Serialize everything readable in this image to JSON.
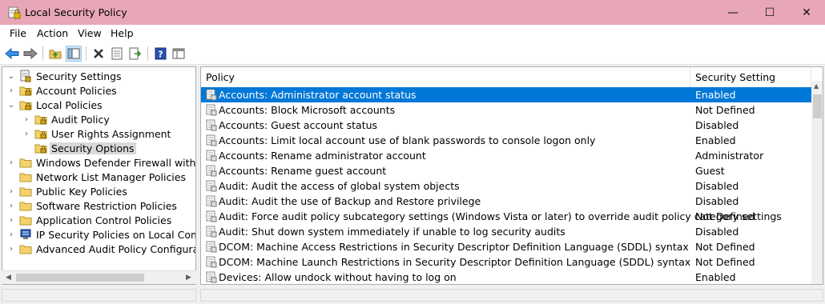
{
  "window": {
    "title": "Local Security Policy",
    "minimize_glyph": "—",
    "maximize_glyph": "☐",
    "close_glyph": "✕"
  },
  "menu": [
    "File",
    "Action",
    "View",
    "Help"
  ],
  "toolbar": {
    "icons": [
      "back-arrow-icon",
      "forward-arrow-icon",
      "up-folder-icon",
      "show-hide-tree-icon",
      "delete-icon",
      "properties-icon",
      "export-list-icon",
      "help-icon",
      "console-view-icon"
    ]
  },
  "tree": {
    "items": [
      {
        "label": "Security Settings",
        "arrow": "⌄",
        "icon": "security-settings-icon"
      },
      {
        "label": "Account Policies",
        "arrow": "›",
        "icon": "folder-lock-icon"
      },
      {
        "label": "Local Policies",
        "arrow": "⌄",
        "icon": "folder-lock-icon"
      },
      {
        "label": "Audit Policy",
        "arrow": "›",
        "icon": "folder-lock-icon"
      },
      {
        "label": "User Rights Assignment",
        "arrow": "›",
        "icon": "folder-lock-icon"
      },
      {
        "label": "Security Options",
        "arrow": "",
        "icon": "folder-lock-icon"
      },
      {
        "label": "Windows Defender Firewall with Adva",
        "arrow": "›",
        "icon": "folder-icon"
      },
      {
        "label": "Network List Manager Policies",
        "arrow": "",
        "icon": "folder-icon"
      },
      {
        "label": "Public Key Policies",
        "arrow": "›",
        "icon": "folder-icon"
      },
      {
        "label": "Software Restriction Policies",
        "arrow": "›",
        "icon": "folder-icon"
      },
      {
        "label": "Application Control Policies",
        "arrow": "›",
        "icon": "folder-icon"
      },
      {
        "label": "IP Security Policies on Local Compute",
        "arrow": "›",
        "icon": "ip-security-icon"
      },
      {
        "label": "Advanced Audit Policy Configuration",
        "arrow": "›",
        "icon": "folder-icon"
      }
    ],
    "selected": "Security Options"
  },
  "table": {
    "columns": [
      "Policy",
      "Security Setting"
    ],
    "sort_glyph": "^",
    "rows": [
      {
        "policy": "Accounts: Administrator account status",
        "setting": "Enabled"
      },
      {
        "policy": "Accounts: Block Microsoft accounts",
        "setting": "Not Defined"
      },
      {
        "policy": "Accounts: Guest account status",
        "setting": "Disabled"
      },
      {
        "policy": "Accounts: Limit local account use of blank passwords to console logon only",
        "setting": "Enabled"
      },
      {
        "policy": "Accounts: Rename administrator account",
        "setting": "Administrator"
      },
      {
        "policy": "Accounts: Rename guest account",
        "setting": "Guest"
      },
      {
        "policy": "Audit: Audit the access of global system objects",
        "setting": "Disabled"
      },
      {
        "policy": "Audit: Audit the use of Backup and Restore privilege",
        "setting": "Disabled"
      },
      {
        "policy": "Audit: Force audit policy subcategory settings (Windows Vista or later) to override audit policy category settings",
        "setting": "Not Defined"
      },
      {
        "policy": "Audit: Shut down system immediately if unable to log security audits",
        "setting": "Disabled"
      },
      {
        "policy": "DCOM: Machine Access Restrictions in Security Descriptor Definition Language (SDDL) syntax",
        "setting": "Not Defined"
      },
      {
        "policy": "DCOM: Machine Launch Restrictions in Security Descriptor Definition Language (SDDL) syntax",
        "setting": "Not Defined"
      },
      {
        "policy": "Devices: Allow undock without having to log on",
        "setting": "Enabled"
      }
    ],
    "selected_row": 0
  },
  "colors": {
    "titlebar": "#e8a7b6",
    "selection": "#0078d7",
    "tree_selection": "#d9d9d9"
  }
}
